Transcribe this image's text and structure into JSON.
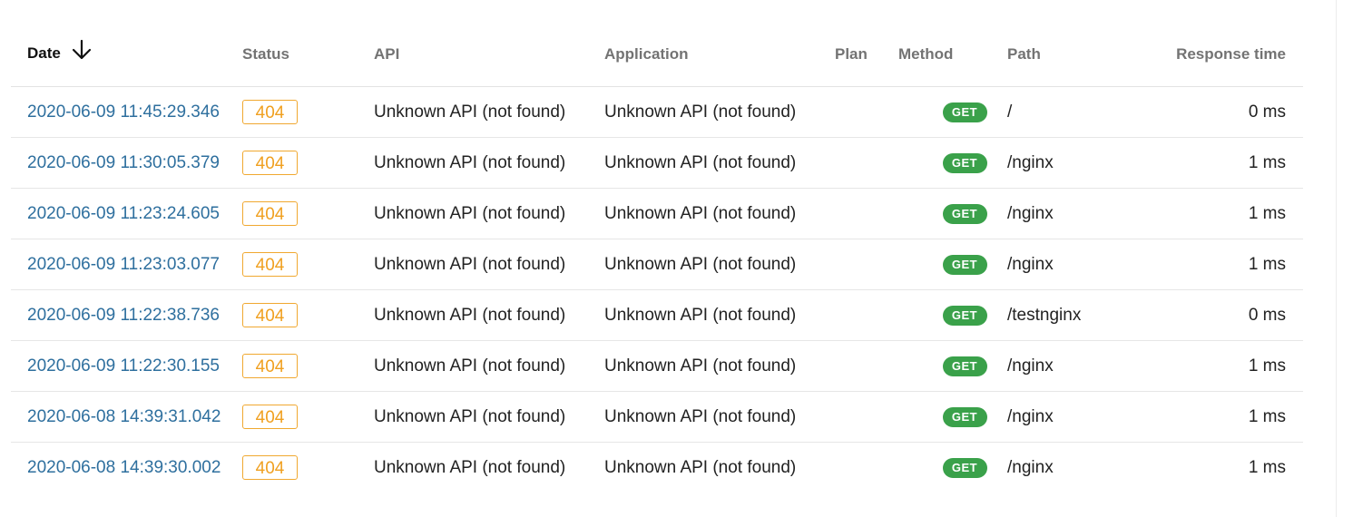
{
  "table": {
    "columns": {
      "date": "Date",
      "status": "Status",
      "api": "API",
      "application": "Application",
      "plan": "Plan",
      "method": "Method",
      "path": "Path",
      "response_time": "Response time"
    },
    "sort": {
      "column": "Date",
      "direction": "descending",
      "icon": "arrow-down-icon"
    },
    "colors": {
      "date_link": "#2e6f9e",
      "status_badge": "#f0a020",
      "method_badge": "#3aa14a"
    },
    "rows": [
      {
        "date": "2020-06-09 11:45:29.346",
        "status": "404",
        "api": "Unknown API (not found)",
        "application": "Unknown API (not found)",
        "plan": "",
        "method": "GET",
        "path": "/",
        "response_time": "0 ms"
      },
      {
        "date": "2020-06-09 11:30:05.379",
        "status": "404",
        "api": "Unknown API (not found)",
        "application": "Unknown API (not found)",
        "plan": "",
        "method": "GET",
        "path": "/nginx",
        "response_time": "1 ms"
      },
      {
        "date": "2020-06-09 11:23:24.605",
        "status": "404",
        "api": "Unknown API (not found)",
        "application": "Unknown API (not found)",
        "plan": "",
        "method": "GET",
        "path": "/nginx",
        "response_time": "1 ms"
      },
      {
        "date": "2020-06-09 11:23:03.077",
        "status": "404",
        "api": "Unknown API (not found)",
        "application": "Unknown API (not found)",
        "plan": "",
        "method": "GET",
        "path": "/nginx",
        "response_time": "1 ms"
      },
      {
        "date": "2020-06-09 11:22:38.736",
        "status": "404",
        "api": "Unknown API (not found)",
        "application": "Unknown API (not found)",
        "plan": "",
        "method": "GET",
        "path": "/testnginx",
        "response_time": "0 ms"
      },
      {
        "date": "2020-06-09 11:22:30.155",
        "status": "404",
        "api": "Unknown API (not found)",
        "application": "Unknown API (not found)",
        "plan": "",
        "method": "GET",
        "path": "/nginx",
        "response_time": "1 ms"
      },
      {
        "date": "2020-06-08 14:39:31.042",
        "status": "404",
        "api": "Unknown API (not found)",
        "application": "Unknown API (not found)",
        "plan": "",
        "method": "GET",
        "path": "/nginx",
        "response_time": "1 ms"
      },
      {
        "date": "2020-06-08 14:39:30.002",
        "status": "404",
        "api": "Unknown API (not found)",
        "application": "Unknown API (not found)",
        "plan": "",
        "method": "GET",
        "path": "/nginx",
        "response_time": "1 ms"
      }
    ]
  }
}
